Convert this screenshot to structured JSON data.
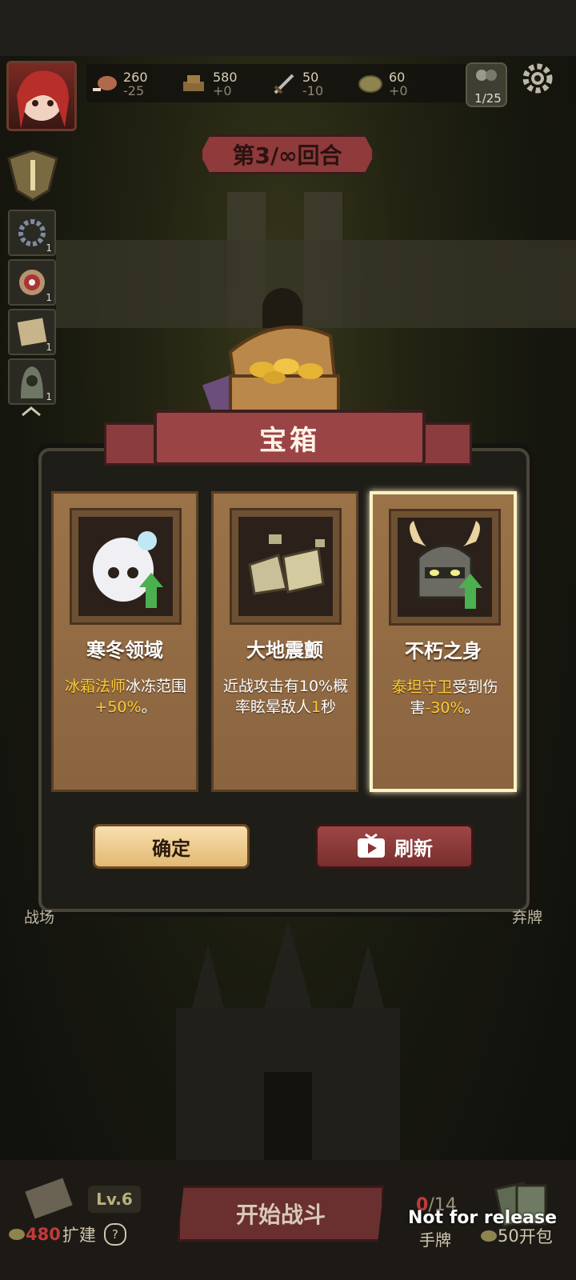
{
  "resources": [
    {
      "icon": "meat-icon",
      "value": "260",
      "delta": "-25"
    },
    {
      "icon": "wood-icon",
      "value": "580",
      "delta": "+0"
    },
    {
      "icon": "sword-icon",
      "value": "50",
      "delta": "-10"
    },
    {
      "icon": "coin-icon",
      "value": "60",
      "delta": "+0"
    }
  ],
  "team_count": "1/25",
  "round_label": "第3/∞回合",
  "side_skills": [
    {
      "icon": "gear-skill-icon",
      "count": "1"
    },
    {
      "icon": "target-icon",
      "count": "1"
    },
    {
      "icon": "map-scroll-icon",
      "count": "1"
    },
    {
      "icon": "hooded-figure-icon",
      "count": "1"
    }
  ],
  "modal": {
    "title": "宝箱",
    "cards": [
      {
        "name": "寒冬领域",
        "icon": "ice-maiden-icon",
        "desc_pre": "",
        "desc_hl": "冰霜法师",
        "desc_mid": "冰冻范围",
        "desc_hl2": "+50%",
        "desc_post": "。",
        "selected": false
      },
      {
        "name": "大地震颤",
        "icon": "cracked-rock-icon",
        "desc_pre": "近战攻击有10%概率眩晕敌人",
        "desc_hl": "1",
        "desc_mid": "秒",
        "desc_hl2": "",
        "desc_post": "",
        "selected": false
      },
      {
        "name": "不朽之身",
        "icon": "horned-helmet-icon",
        "desc_pre": "",
        "desc_hl": "泰坦守卫",
        "desc_mid": "受到伤害",
        "desc_hl2": "-30%",
        "desc_post": "。",
        "selected": true
      }
    ],
    "confirm_label": "确定",
    "refresh_label": "刷新"
  },
  "side_labels": {
    "left": "战场",
    "right": "弃牌"
  },
  "bottom": {
    "level": "Lv.6",
    "expand_cost": "480",
    "expand_label": "扩建",
    "help": "?",
    "start_label": "开始战斗",
    "hand_count": "0",
    "hand_max": "/14",
    "hand_label": "手牌",
    "pack_cost": "50",
    "pack_label": "开包"
  },
  "watermark": "Not for release",
  "colors": {
    "highlight": "#ffcc33",
    "banner": "#9a4446",
    "card": "#9b7348"
  }
}
